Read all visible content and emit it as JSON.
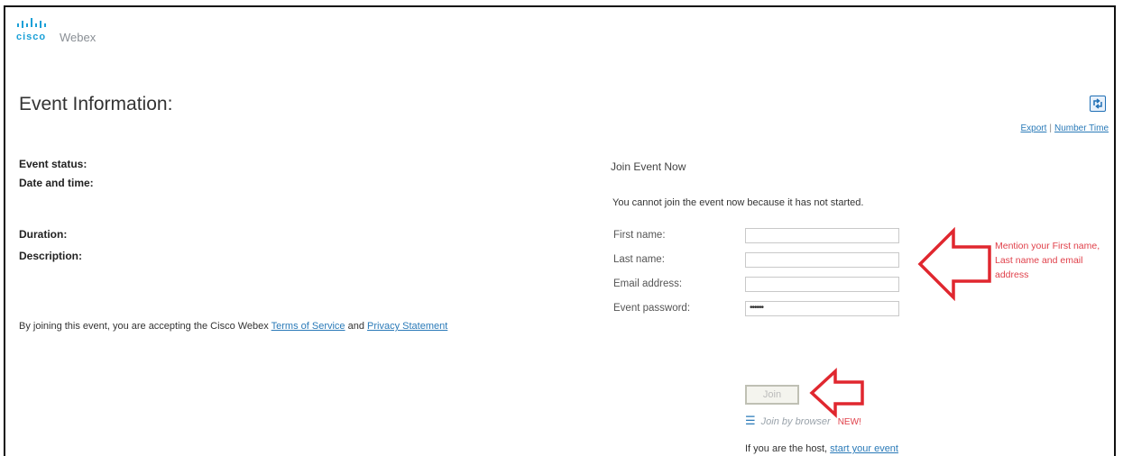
{
  "brand": {
    "company": "cisco",
    "product": "Webex",
    "accent_color": "#1ba0d7",
    "link_color": "#2a7ab8",
    "annotation_color": "#e0404a"
  },
  "page": {
    "title": "Event Information:",
    "export_icon": "export-icon",
    "links": [
      "Export",
      "Number Time"
    ]
  },
  "event_details": {
    "status_label": "Event status:",
    "date_label": "Date and time:",
    "duration_label": "Duration:",
    "description_label": "Description:"
  },
  "terms": {
    "prefix": "By joining this event, you are accepting the Cisco Webex ",
    "terms_link": "Terms of Service",
    "and": " and ",
    "privacy_link": "Privacy Statement"
  },
  "join": {
    "heading": "Join Event Now",
    "message": "You cannot join the event now because it has not started.",
    "fields": {
      "first_name": {
        "label": "First name:",
        "value": ""
      },
      "last_name": {
        "label": "Last name:",
        "value": ""
      },
      "email": {
        "label": "Email address:",
        "value": ""
      },
      "password": {
        "label": "Event password:",
        "value": "••••••"
      }
    },
    "join_button": "Join",
    "browser_icon": "browser-icon",
    "browser_text": "Join by browser",
    "new_badge": "NEW!",
    "host_text": "If you are the host, ",
    "host_link": "start your event"
  },
  "annotation": {
    "text": "Mention your First name, Last name and email address"
  }
}
